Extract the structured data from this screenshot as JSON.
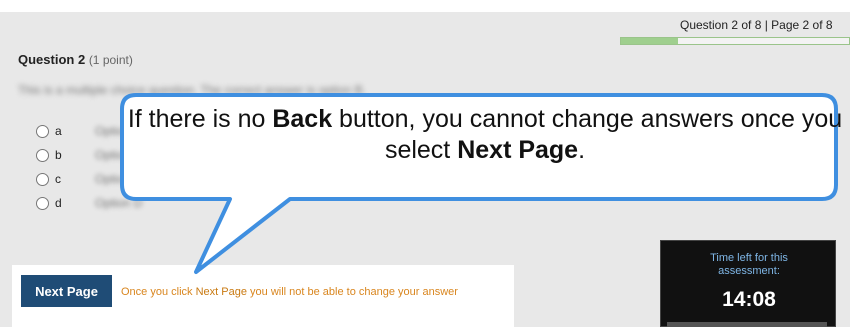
{
  "header": {
    "progress_text": "Question 2 of 8 | Page 2 of 8",
    "progress_fraction": 0.25
  },
  "question": {
    "title": "Question 2",
    "points": "(1 point)"
  },
  "options": [
    {
      "letter": "a",
      "text": "Option A"
    },
    {
      "letter": "b",
      "text": "Option B"
    },
    {
      "letter": "c",
      "text": "Option C"
    },
    {
      "letter": "d",
      "text": "Option D"
    }
  ],
  "navigation": {
    "next_label": "Next Page",
    "warning_prefix": "Once you click ",
    "warning_emphasis": "Next Page",
    "warning_suffix": " you will not be able to change your answer"
  },
  "timer": {
    "label_line1": "Time left for this",
    "label_line2": "assessment:",
    "value": "14:08"
  },
  "callout": {
    "part1": "If there is no ",
    "bold1": "Back",
    "part2": " button, you cannot change answers once you select ",
    "bold2": "Next Page",
    "part3": "."
  },
  "colors": {
    "button": "#1f4c76",
    "warning": "#d9861f",
    "callout_border": "#3f8fe0",
    "progress_fill": "#9fcf8e"
  }
}
